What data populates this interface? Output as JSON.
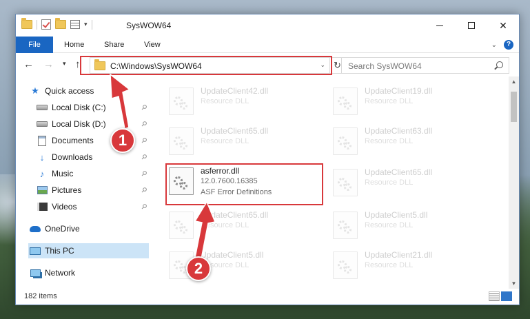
{
  "window": {
    "title": "SysWOW64",
    "qat_dropdown": "▾"
  },
  "controls": {
    "minimize": "",
    "maximize": "",
    "close": "✕"
  },
  "ribbon": {
    "tabs": [
      {
        "label": "File",
        "active": true
      },
      {
        "label": "Home"
      },
      {
        "label": "Share"
      },
      {
        "label": "View"
      }
    ],
    "collapse_icon": "chevron-down-icon",
    "help_label": "?"
  },
  "navigation": {
    "back": "←",
    "forward": "→",
    "recent": "▾",
    "up": "↑"
  },
  "address": {
    "path": "C:\\Windows\\SysWOW64",
    "dropdown": "⌄",
    "refresh": "↻"
  },
  "search": {
    "placeholder": "Search SysWOW64"
  },
  "sidebar": {
    "items": [
      {
        "label": "Quick access",
        "icon": "star-icon"
      },
      {
        "label": "Local Disk (C:)",
        "icon": "disk-icon",
        "pinned": true
      },
      {
        "label": "Local Disk (D:)",
        "icon": "disk-icon",
        "pinned": true
      },
      {
        "label": "Documents",
        "icon": "documents-icon",
        "pinned": true
      },
      {
        "label": "Downloads",
        "icon": "downloads-icon",
        "pinned": true
      },
      {
        "label": "Music",
        "icon": "music-icon",
        "pinned": true
      },
      {
        "label": "Pictures",
        "icon": "pictures-icon",
        "pinned": true
      },
      {
        "label": "Videos",
        "icon": "videos-icon",
        "pinned": true
      },
      {
        "label": "OneDrive",
        "icon": "onedrive-icon"
      },
      {
        "label": "This PC",
        "icon": "computer-icon",
        "selected": true
      },
      {
        "label": "Network",
        "icon": "network-icon"
      }
    ],
    "pin_glyph": "📌"
  },
  "files": {
    "left": [
      {
        "name": "UpdateClient42.dll",
        "desc": "Resource DLL",
        "faded": true
      },
      {
        "name": "UpdateClient65.dll",
        "desc": "Resource DLL",
        "faded": true
      },
      {
        "name": "asferror.dll",
        "desc": "12.0.7600.16385",
        "desc2": "ASF Error Definitions",
        "faded": false
      },
      {
        "name": "UpdateClient65.dll",
        "desc": "Resource DLL",
        "faded": true
      },
      {
        "name": "UpdateClient5.dll",
        "desc": "Resource DLL",
        "faded": true
      }
    ],
    "right": [
      {
        "name": "UpdateClient19.dll",
        "desc": "Resource DLL",
        "faded": true
      },
      {
        "name": "UpdateClient63.dll",
        "desc": "Resource DLL",
        "faded": true
      },
      {
        "name": "UpdateClient65.dll",
        "desc": "Resource DLL",
        "faded": true
      },
      {
        "name": "UpdateClient5.dll",
        "desc": "Resource DLL",
        "faded": true
      },
      {
        "name": "UpdateClient21.dll",
        "desc": "Resource DLL",
        "faded": true
      }
    ]
  },
  "scrollbar": {
    "up": "▲",
    "down": "▼"
  },
  "status": {
    "items_count": "182 items"
  },
  "annotations": {
    "badge_1": "1",
    "badge_2": "2",
    "color": "#d8383b"
  }
}
